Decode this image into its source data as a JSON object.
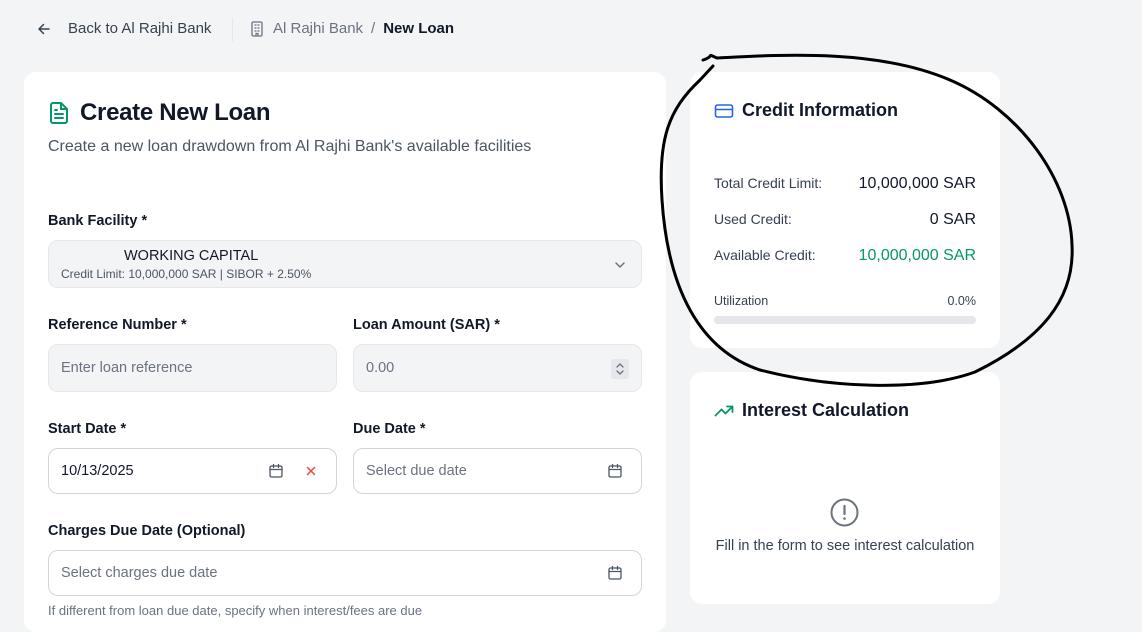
{
  "nav": {
    "back_label": "Back to Al Rajhi Bank",
    "breadcrumb": [
      "Al Rajhi Bank",
      "New Loan"
    ],
    "breadcrumb_separator": "/"
  },
  "form": {
    "title": "Create New Loan",
    "subtitle": "Create a new loan drawdown from Al Rajhi Bank's available facilities",
    "facility": {
      "label": "Bank Facility *",
      "selected": "WORKING CAPITAL",
      "detail": "Credit Limit: 10,000,000 SAR | SIBOR + 2.50%"
    },
    "reference": {
      "label": "Reference Number *",
      "placeholder": "Enter loan reference"
    },
    "amount": {
      "label": "Loan Amount (SAR) *",
      "placeholder": "0.00"
    },
    "start_date": {
      "label": "Start Date *",
      "value": "10/13/2025"
    },
    "due_date": {
      "label": "Due Date *",
      "placeholder": "Select due date"
    },
    "charges_due_date": {
      "label": "Charges Due Date (Optional)",
      "placeholder": "Select charges due date",
      "hint": "If different from loan due date, specify when interest/fees are due"
    }
  },
  "credit": {
    "title": "Credit Information",
    "rows": [
      {
        "label": "Total Credit Limit:",
        "value": "10,000,000 SAR"
      },
      {
        "label": "Used Credit:",
        "value": "0 SAR"
      },
      {
        "label": "Available Credit:",
        "value": "10,000,000 SAR"
      }
    ],
    "utilization_label": "Utilization",
    "utilization_value": "0.0%",
    "utilization_fraction": 0.0
  },
  "interest": {
    "title": "Interest Calculation",
    "empty_message": "Fill in the form to see interest calculation"
  },
  "colors": {
    "accent_green": "#059669",
    "accent_blue": "#2563eb",
    "clear_red": "#ef4444",
    "annotation_ink": "#000000"
  },
  "icons": {
    "back": "arrow-left-icon",
    "breadcrumb": "building-icon",
    "title": "file-text-icon",
    "credit": "credit-card-icon",
    "interest": "trending-up-icon",
    "empty": "alert-circle-icon"
  }
}
